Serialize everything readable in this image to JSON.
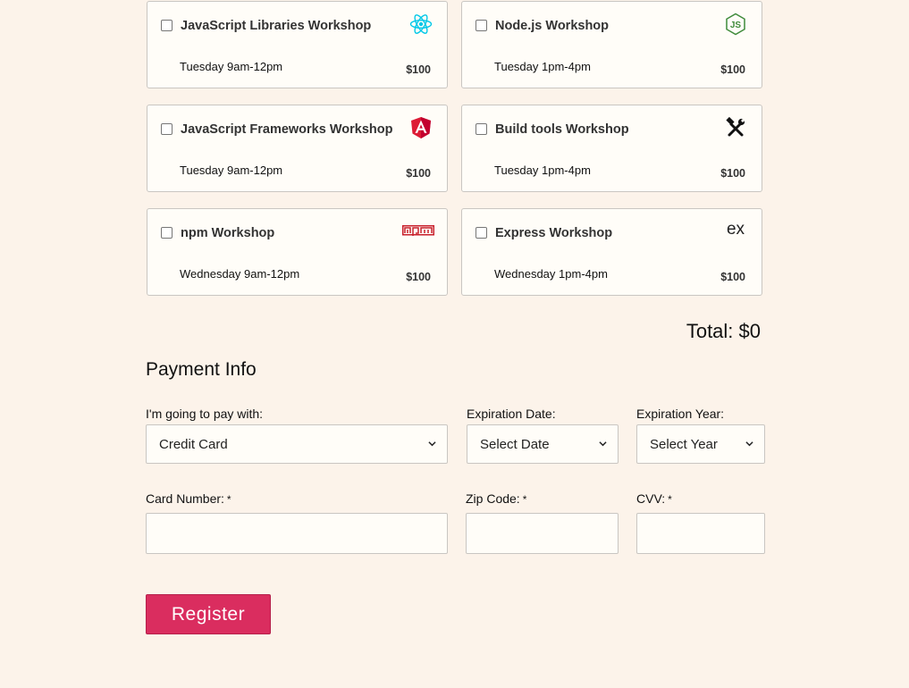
{
  "activities": [
    {
      "title": "JavaScript Libraries Workshop",
      "time": "Tuesday 9am-12pm",
      "price": "$100",
      "icon": "react-icon"
    },
    {
      "title": "Node.js Workshop",
      "time": "Tuesday 1pm-4pm",
      "price": "$100",
      "icon": "nodejs-icon"
    },
    {
      "title": "JavaScript Frameworks Workshop",
      "time": "Tuesday 9am-12pm",
      "price": "$100",
      "icon": "angular-icon"
    },
    {
      "title": "Build tools Workshop",
      "time": "Tuesday 1pm-4pm",
      "price": "$100",
      "icon": "hammer-wrench-icon"
    },
    {
      "title": "npm Workshop",
      "time": "Wednesday 9am-12pm",
      "price": "$100",
      "icon": "npm-icon"
    },
    {
      "title": "Express Workshop",
      "time": "Wednesday 1pm-4pm",
      "price": "$100",
      "icon": "express-icon",
      "icon_text": "ex"
    }
  ],
  "total": "Total: $0",
  "payment": {
    "title": "Payment Info",
    "method_label": "I'm going to pay with:",
    "method_value": "Credit Card",
    "exp_date_label": "Expiration Date:",
    "exp_date_value": "Select Date",
    "exp_year_label": "Expiration Year:",
    "exp_year_value": "Select Year",
    "card_label": "Card Number:",
    "zip_label": "Zip Code:",
    "cvv_label": "CVV:",
    "required_mark": "*"
  },
  "register_label": "Register",
  "colors": {
    "background": "#fcf3ea",
    "card": "#fffdf8",
    "accent": "#da2d5f",
    "react": "#00c8e8",
    "node": "#3f8b3b",
    "angular": "#dd1b35",
    "npm": "#c8202b"
  }
}
